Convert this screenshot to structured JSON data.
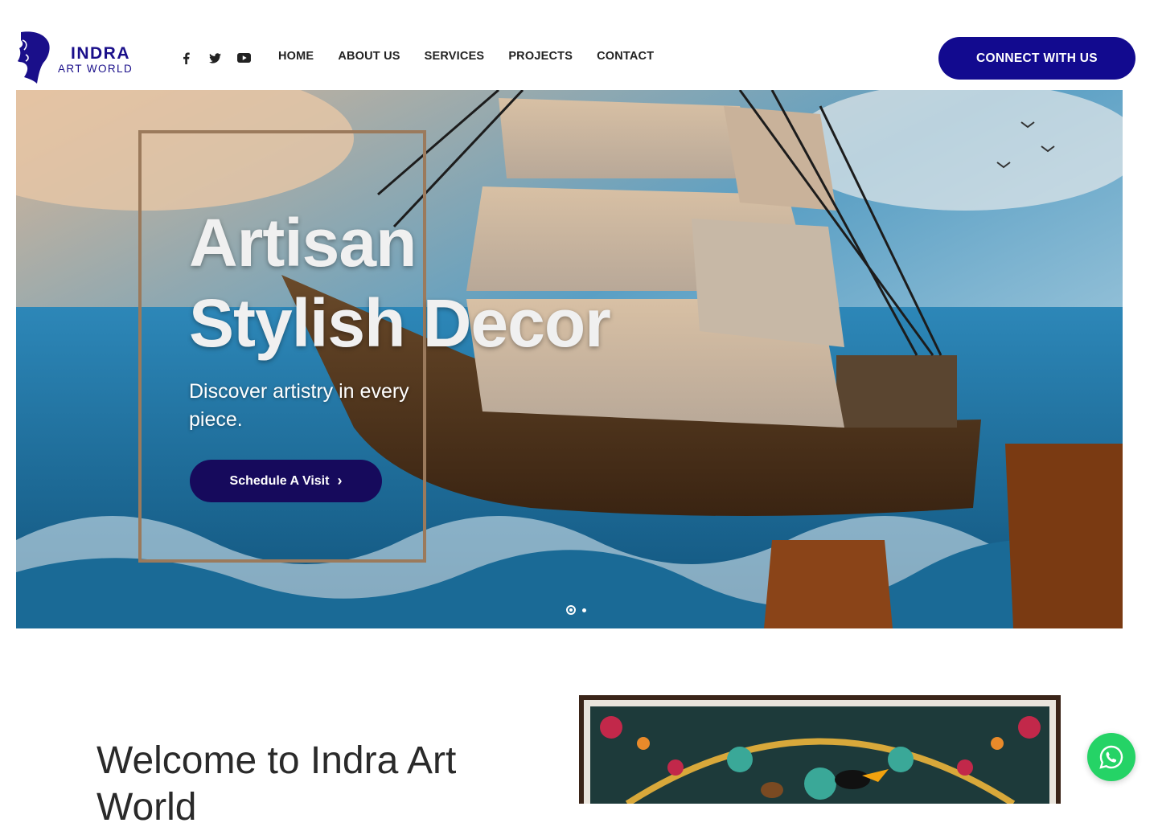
{
  "brand": {
    "name": "INDRA",
    "tagline": "ART WORLD",
    "primary_color": "#120a8f"
  },
  "socials": [
    {
      "icon": "facebook-icon"
    },
    {
      "icon": "twitter-icon"
    },
    {
      "icon": "youtube-icon"
    }
  ],
  "nav": {
    "items": [
      "HOME",
      "ABOUT US",
      "SERVICES",
      "PROJECTS",
      "CONTACT"
    ]
  },
  "header": {
    "cta_label": "CONNECT WITH US"
  },
  "hero": {
    "title_line1": "Artisan",
    "title_line2": "Stylish Decor",
    "subtitle": "Discover artistry in every piece.",
    "button_label": "Schedule A Visit",
    "slides_total": 2,
    "active_slide": 1
  },
  "welcome": {
    "heading": "Welcome to Indra Art World"
  },
  "floating": {
    "icon": "whatsapp-icon"
  }
}
